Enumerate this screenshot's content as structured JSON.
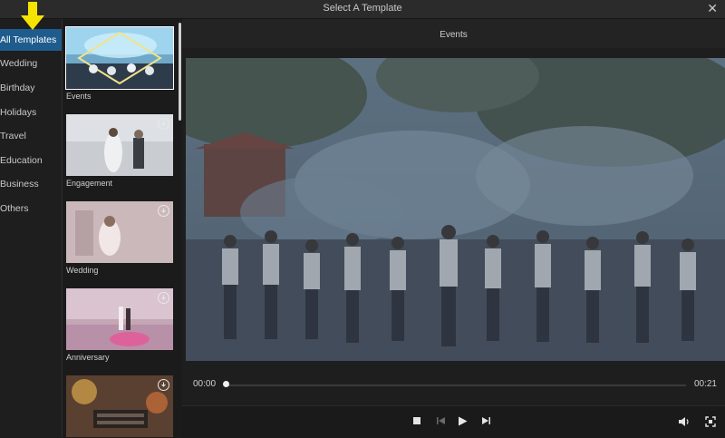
{
  "window": {
    "title": "Select A Template",
    "close_glyph": "✕"
  },
  "sidebar": {
    "items": [
      {
        "label": "All Templates",
        "active": true
      },
      {
        "label": "Wedding"
      },
      {
        "label": "Birthday"
      },
      {
        "label": "Holidays"
      },
      {
        "label": "Travel"
      },
      {
        "label": "Education"
      },
      {
        "label": "Business"
      },
      {
        "label": "Others"
      }
    ]
  },
  "templates": [
    {
      "label": "Events",
      "selected": true,
      "download": false
    },
    {
      "label": "Engagement",
      "download": true
    },
    {
      "label": "Wedding",
      "download": true
    },
    {
      "label": "Anniversary",
      "download": true
    },
    {
      "label": "",
      "download": true
    }
  ],
  "preview": {
    "header": "Events",
    "time_current": "00:00",
    "time_total": "00:21",
    "progress": 0.0
  },
  "icons": [
    "yellow-arrow-down-icon",
    "close-icon",
    "download-icon",
    "stop-icon",
    "previous-frame-icon",
    "play-icon",
    "next-frame-icon",
    "volume-icon",
    "fullscreen-icon"
  ],
  "colors": {
    "accent": "#1f5c8e",
    "arrow": "#f5e400"
  }
}
